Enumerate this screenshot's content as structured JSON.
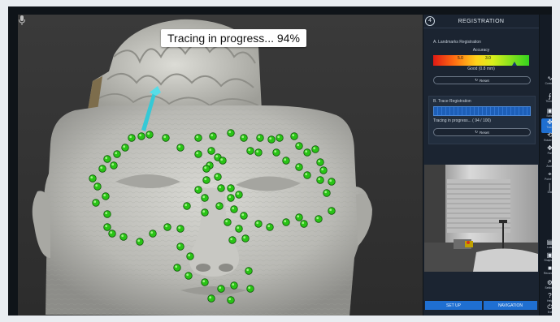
{
  "viewport": {
    "progress_banner": "Tracing in progress... 94%"
  },
  "panel": {
    "step_number": "4",
    "title": "REGISTRATION",
    "landmarks": {
      "section_title": "A. Landmarks Registration",
      "accuracy_label": "Accuracy",
      "tick_low": "5.0",
      "tick_high": "3.0",
      "accuracy_value_text": "Good (0.8 mm)",
      "accuracy_fraction": 0.85,
      "reset_label": "Reset"
    },
    "trace": {
      "section_title": "B. Trace Registration",
      "progress_fraction": 0.94,
      "status_text": "Tracing in progress... ( 94 / 100)",
      "reset_label": "Reset"
    },
    "buttons": {
      "setup": "SET UP",
      "navigation": "NAVIGATION"
    }
  },
  "toolbar": {
    "tools": [
      {
        "icon": "curve-icon",
        "glyph": "∿",
        "label": "Contour"
      },
      {
        "icon": "threshold-icon",
        "glyph": "⨍",
        "label": "Thresh"
      },
      {
        "icon": "cube-icon",
        "glyph": "▣",
        "label": "Scroll"
      },
      {
        "icon": "trace-icon",
        "glyph": "✤",
        "label": "Trace"
      },
      {
        "icon": "rotate-icon",
        "glyph": "⟲",
        "label": "Rotate 3D"
      },
      {
        "icon": "pan-icon",
        "glyph": "✥",
        "label": "Pan"
      },
      {
        "icon": "zoom-icon",
        "glyph": "⌕",
        "label": "Zoom"
      },
      {
        "icon": "point-icon",
        "glyph": "⌖",
        "label": "Point Co"
      },
      {
        "icon": "ruler-icon",
        "glyph": "│",
        "label": "Dist"
      },
      {
        "icon": "load-icon",
        "glyph": "▤",
        "label": "Load"
      },
      {
        "icon": "snapshot-icon",
        "glyph": "▣",
        "label": "Snapshot"
      },
      {
        "icon": "recording-icon",
        "glyph": "■",
        "label": "Recording"
      },
      {
        "icon": "settings-icon",
        "glyph": "⚙",
        "label": "Settings"
      },
      {
        "icon": "help-icon",
        "glyph": "?",
        "label": "Help"
      },
      {
        "icon": "power-icon",
        "glyph": "⏻",
        "label": "Exit"
      }
    ],
    "active_index": 3
  },
  "colors": {
    "accent": "#1f6fd1",
    "landmark_green": "#29c416",
    "probe_cyan": "#35c9d6"
  }
}
